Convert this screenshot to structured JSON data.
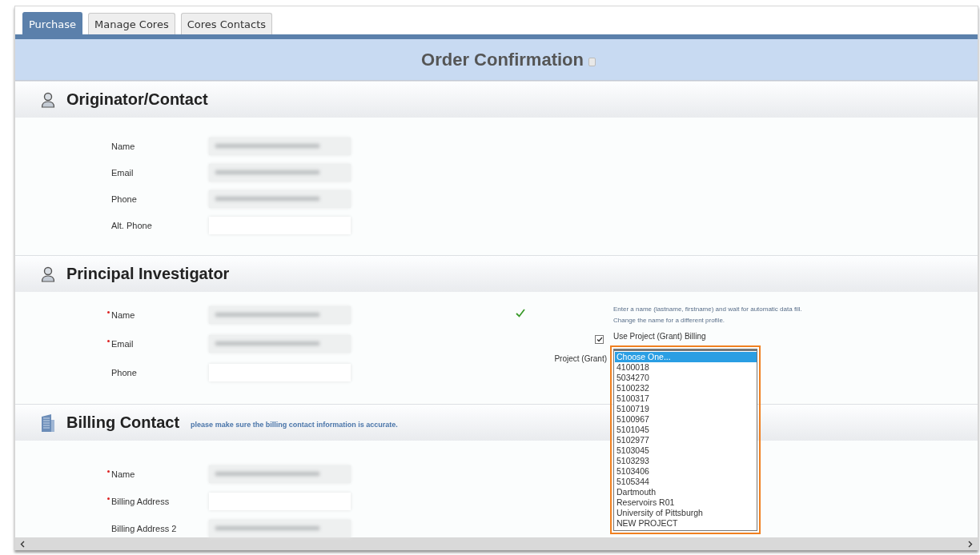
{
  "tabs": [
    {
      "label": "Purchase",
      "selected": true
    },
    {
      "label": "Manage Cores",
      "selected": false
    },
    {
      "label": "Cores Contacts",
      "selected": false
    }
  ],
  "page_title": "Order Confirmation",
  "sections": [
    {
      "title": "Originator/Contact",
      "fields": [
        {
          "label": "Name",
          "required": false,
          "kind": "blurred"
        },
        {
          "label": "Email",
          "required": false,
          "kind": "blurred"
        },
        {
          "label": "Phone",
          "required": false,
          "kind": "blurred"
        },
        {
          "label": "Alt. Phone",
          "required": false,
          "kind": "empty"
        }
      ]
    },
    {
      "title": "Principal Investigator",
      "fields": [
        {
          "label": "Name",
          "required": true,
          "kind": "blurred"
        },
        {
          "label": "Email",
          "required": true,
          "kind": "blurred"
        },
        {
          "label": "Phone",
          "required": false,
          "kind": "empty"
        }
      ]
    },
    {
      "title": "Billing Contact",
      "note": "please make sure the billing contact information is accurate.",
      "fields": [
        {
          "label": "Name",
          "required": true,
          "kind": "blurred"
        },
        {
          "label": "Billing Address",
          "required": true,
          "kind": "empty"
        },
        {
          "label": "Billing Address 2",
          "required": false,
          "kind": "blurred"
        }
      ]
    }
  ],
  "pi_side": {
    "valid": true,
    "help": [
      "Enter a name (lastname, firstname) and wait for automatic data fill.",
      "Change the name for a different profile."
    ],
    "use_grant_billing": {
      "label": "Use Project (Grant) Billing",
      "checked": true
    },
    "project_label": "Project (Grant)",
    "highlighted": true,
    "project_options": [
      {
        "label": "Choose One...",
        "selected": true
      },
      {
        "label": "4100018",
        "selected": false
      },
      {
        "label": "5034270",
        "selected": false
      },
      {
        "label": "5100232",
        "selected": false
      },
      {
        "label": "5100317",
        "selected": false
      },
      {
        "label": "5100719",
        "selected": false
      },
      {
        "label": "5100967",
        "selected": false
      },
      {
        "label": "5101045",
        "selected": false
      },
      {
        "label": "5102977",
        "selected": false
      },
      {
        "label": "5103045",
        "selected": false
      },
      {
        "label": "5103293",
        "selected": false
      },
      {
        "label": "5103406",
        "selected": false
      },
      {
        "label": "5105344",
        "selected": false
      },
      {
        "label": "Dartmouth",
        "selected": false
      },
      {
        "label": "Reservoirs R01",
        "selected": false
      },
      {
        "label": "University of Pittsburgh",
        "selected": false
      },
      {
        "label": "NEW PROJECT",
        "selected": false
      }
    ]
  }
}
